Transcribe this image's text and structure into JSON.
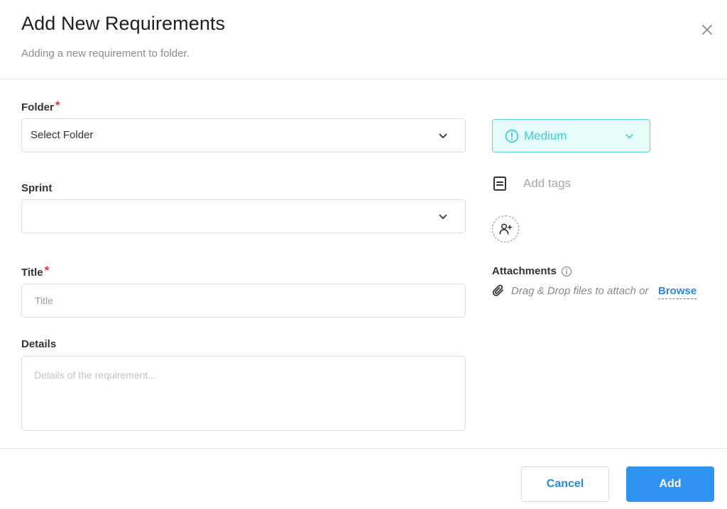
{
  "header": {
    "title": "Add New Requirements",
    "subtitle": "Adding a new requirement to folder.",
    "close_icon": "close-icon"
  },
  "form": {
    "folder": {
      "label": "Folder",
      "required_mark": "*",
      "selected": "Select Folder"
    },
    "sprint": {
      "label": "Sprint",
      "selected": ""
    },
    "title": {
      "label": "Title",
      "required_mark": "*",
      "value": "",
      "placeholder": "Title"
    },
    "details": {
      "label": "Details",
      "value": "",
      "placeholder": "Details of the requirement..."
    }
  },
  "sidebar": {
    "priority": {
      "label": "Medium",
      "icon": "exclamation-circle-icon",
      "color": "#3ecfd0"
    },
    "tags": {
      "placeholder": "Add tags",
      "icon": "tag-list-icon"
    },
    "assignee": {
      "icon": "add-user-icon"
    },
    "attachments": {
      "label": "Attachments",
      "info_icon": "info-icon",
      "drop_text": "Drag & Drop files to attach or",
      "browse_label": "Browse"
    }
  },
  "footer": {
    "cancel_label": "Cancel",
    "add_label": "Add",
    "primary_color": "#2e93f1"
  }
}
